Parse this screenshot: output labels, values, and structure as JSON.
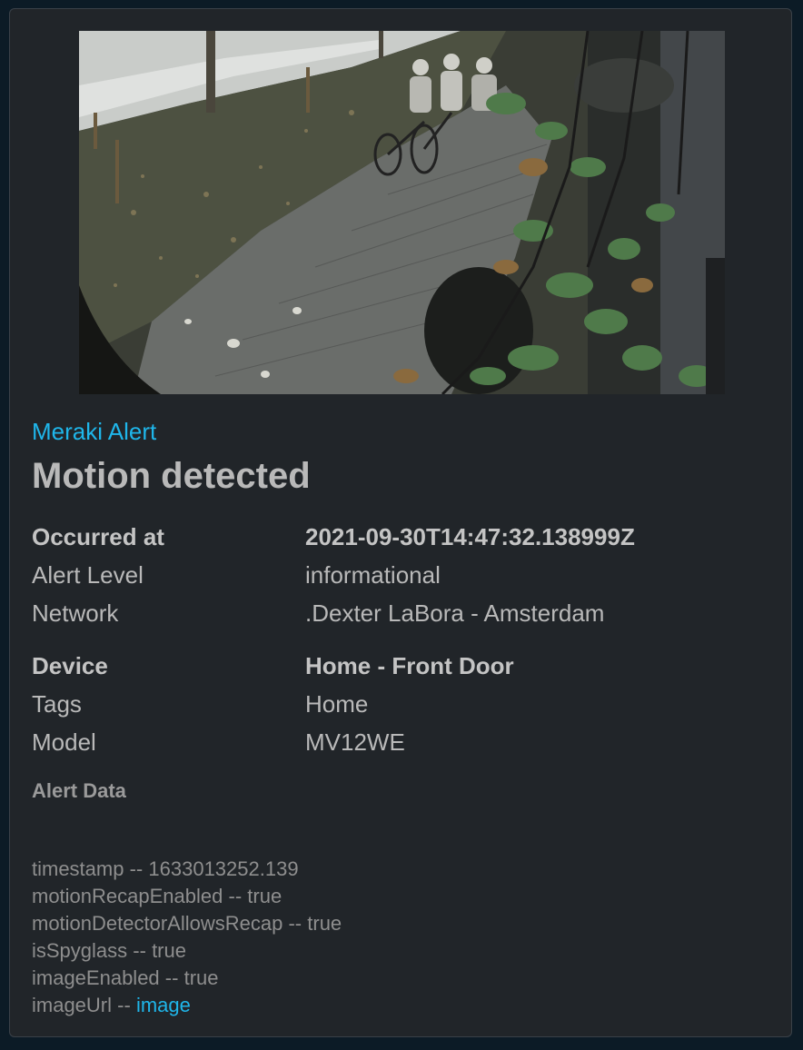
{
  "card": {
    "alert_source": "Meraki Alert",
    "title": "Motion detected",
    "snapshot_icon": "camera-snapshot-image",
    "colors": {
      "link": "#1fb6ea",
      "text": "#b9b9b9",
      "card_bg": "#212529",
      "page_bg": "#0c1b26"
    }
  },
  "details": {
    "occurred_at": {
      "label": "Occurred at",
      "value": "2021-09-30T14:47:32.138999Z"
    },
    "alert_level": {
      "label": "Alert Level",
      "value": "informational"
    },
    "network": {
      "label": "Network",
      "value": ".Dexter LaBora - Amsterdam"
    },
    "device": {
      "label": "Device",
      "value": "Home - Front Door"
    },
    "tags": {
      "label": "Tags",
      "value": "Home"
    },
    "model": {
      "label": "Model",
      "value": "MV12WE"
    }
  },
  "alert_data": {
    "heading": "Alert Data",
    "separator": "--",
    "items": [
      {
        "key": "timestamp",
        "value": "1633013252.139"
      },
      {
        "key": "motionRecapEnabled",
        "value": "true"
      },
      {
        "key": "motionDetectorAllowsRecap",
        "value": "true"
      },
      {
        "key": "isSpyglass",
        "value": "true"
      },
      {
        "key": "imageEnabled",
        "value": "true"
      },
      {
        "key": "imageUrl",
        "value": "image"
      }
    ]
  }
}
